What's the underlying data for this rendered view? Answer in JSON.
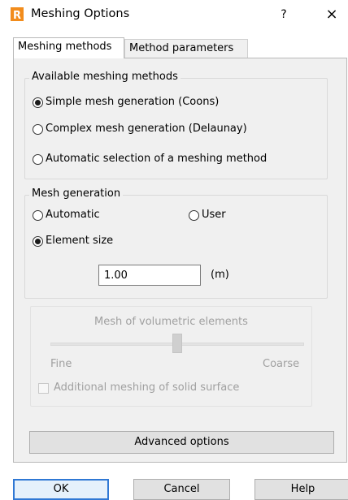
{
  "window": {
    "title": "Meshing Options",
    "help_glyph": "?",
    "close_glyph": "×",
    "brand_color": "#f28c1c"
  },
  "tabs": [
    {
      "label": "Meshing methods",
      "active": true
    },
    {
      "label": "Method parameters",
      "active": false
    }
  ],
  "methods_group": {
    "legend": "Available meshing methods",
    "options": [
      {
        "label": "Simple mesh generation (Coons)",
        "selected": true
      },
      {
        "label": "Complex mesh generation (Delaunay)",
        "selected": false
      },
      {
        "label": "Automatic selection of a meshing method",
        "selected": false
      }
    ]
  },
  "generation_group": {
    "legend": "Mesh generation",
    "options": [
      {
        "label": "Automatic",
        "selected": false
      },
      {
        "label": "User",
        "selected": false
      },
      {
        "label": "Element size",
        "selected": true
      }
    ],
    "size_value": "1.00",
    "size_unit": "(m)"
  },
  "volumetric_group": {
    "legend": "Mesh of volumetric elements",
    "enabled": false,
    "slider_min_label": "Fine",
    "slider_max_label": "Coarse",
    "slider_level": 0.5,
    "checkbox_label": "Additional meshing of solid surface",
    "checkbox_checked": false
  },
  "advanced_button": "Advanced options",
  "footer": {
    "ok": "OK",
    "cancel": "Cancel",
    "help": "Help"
  }
}
